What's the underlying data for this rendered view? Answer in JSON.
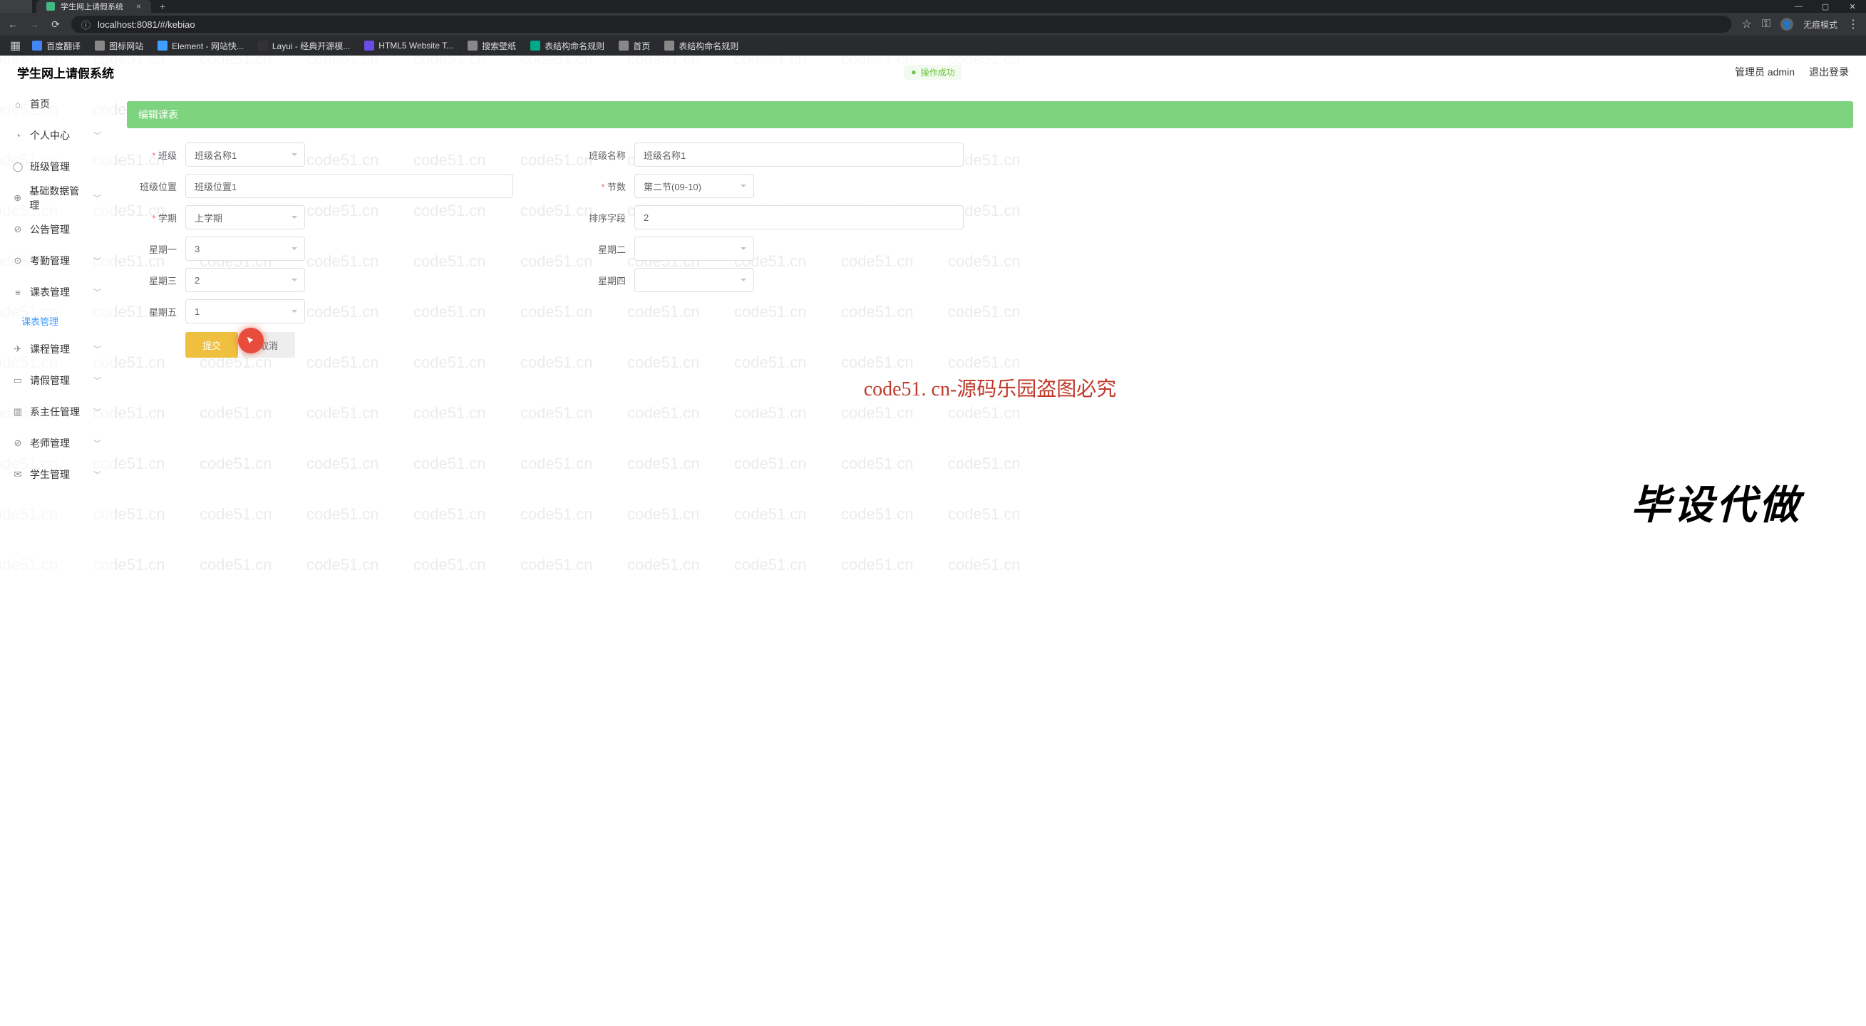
{
  "browser": {
    "tab_title": "学生网上请假系统",
    "plus": "+",
    "url": "localhost:8081/#/kebiao",
    "win_min": "—",
    "win_max": "▢",
    "win_close": "✕",
    "profile": "无痕模式",
    "bookmarks": [
      {
        "label": "百度翻译",
        "c": "#4285f4"
      },
      {
        "label": "图标网站",
        "c": "#888"
      },
      {
        "label": "Element - 网站快...",
        "c": "#409eff"
      },
      {
        "label": "Layui - 经典开源模...",
        "c": "#333"
      },
      {
        "label": "HTML5 Website T...",
        "c": "#6b4ce6"
      },
      {
        "label": "搜索壁纸",
        "c": "#888"
      },
      {
        "label": "表结构命名规则",
        "c": "#0a8"
      },
      {
        "label": "首页",
        "c": "#888"
      },
      {
        "label": "表结构命名规则",
        "c": "#888"
      }
    ]
  },
  "header": {
    "logo": "学生网上请假系统",
    "toast": "操作成功",
    "user": "管理员 admin",
    "logout": "退出登录"
  },
  "sidebar": {
    "items": [
      {
        "icon": "⌂",
        "label": "首页",
        "arrow": false
      },
      {
        "icon": "◔",
        "label": "个人中心",
        "arrow": true
      },
      {
        "icon": "◯",
        "label": "班级管理",
        "arrow": false
      },
      {
        "icon": "⊕",
        "label": "基础数据管理",
        "arrow": true
      },
      {
        "icon": "⊘",
        "label": "公告管理",
        "arrow": false
      },
      {
        "icon": "⊙",
        "label": "考勤管理",
        "arrow": true
      },
      {
        "icon": "≡",
        "label": "课表管理",
        "arrow": true,
        "expanded": true,
        "sub": "课表管理"
      },
      {
        "icon": "✈",
        "label": "课程管理",
        "arrow": true
      },
      {
        "icon": "▭",
        "label": "请假管理",
        "arrow": true
      },
      {
        "icon": "▥",
        "label": "系主任管理",
        "arrow": true
      },
      {
        "icon": "⊘",
        "label": "老师管理",
        "arrow": true
      },
      {
        "icon": "✉",
        "label": "学生管理",
        "arrow": true
      }
    ]
  },
  "page": {
    "title": "编辑课表"
  },
  "form": {
    "class_lbl": "班级",
    "class_val": "班级名称1",
    "classname_lbl": "班级名称",
    "classname_val": "班级名称1",
    "classpos_lbl": "班级位置",
    "classpos_val": "班级位置1",
    "section_lbl": "节数",
    "section_val": "第二节(09-10)",
    "term_lbl": "学期",
    "term_val": "上学期",
    "sort_lbl": "排序字段",
    "sort_val": "2",
    "d1_lbl": "星期一",
    "d1_val": "3",
    "d2_lbl": "星期二",
    "d2_val": "",
    "d3_lbl": "星期三",
    "d3_val": "2",
    "d4_lbl": "星期四",
    "d4_val": "",
    "d5_lbl": "星期五",
    "d5_val": "1",
    "submit": "提交",
    "cancel": "取消"
  },
  "overlay": {
    "big": "毕设代做",
    "red": "code51. cn-源码乐园盗图必究",
    "wm": "code51.cn"
  }
}
